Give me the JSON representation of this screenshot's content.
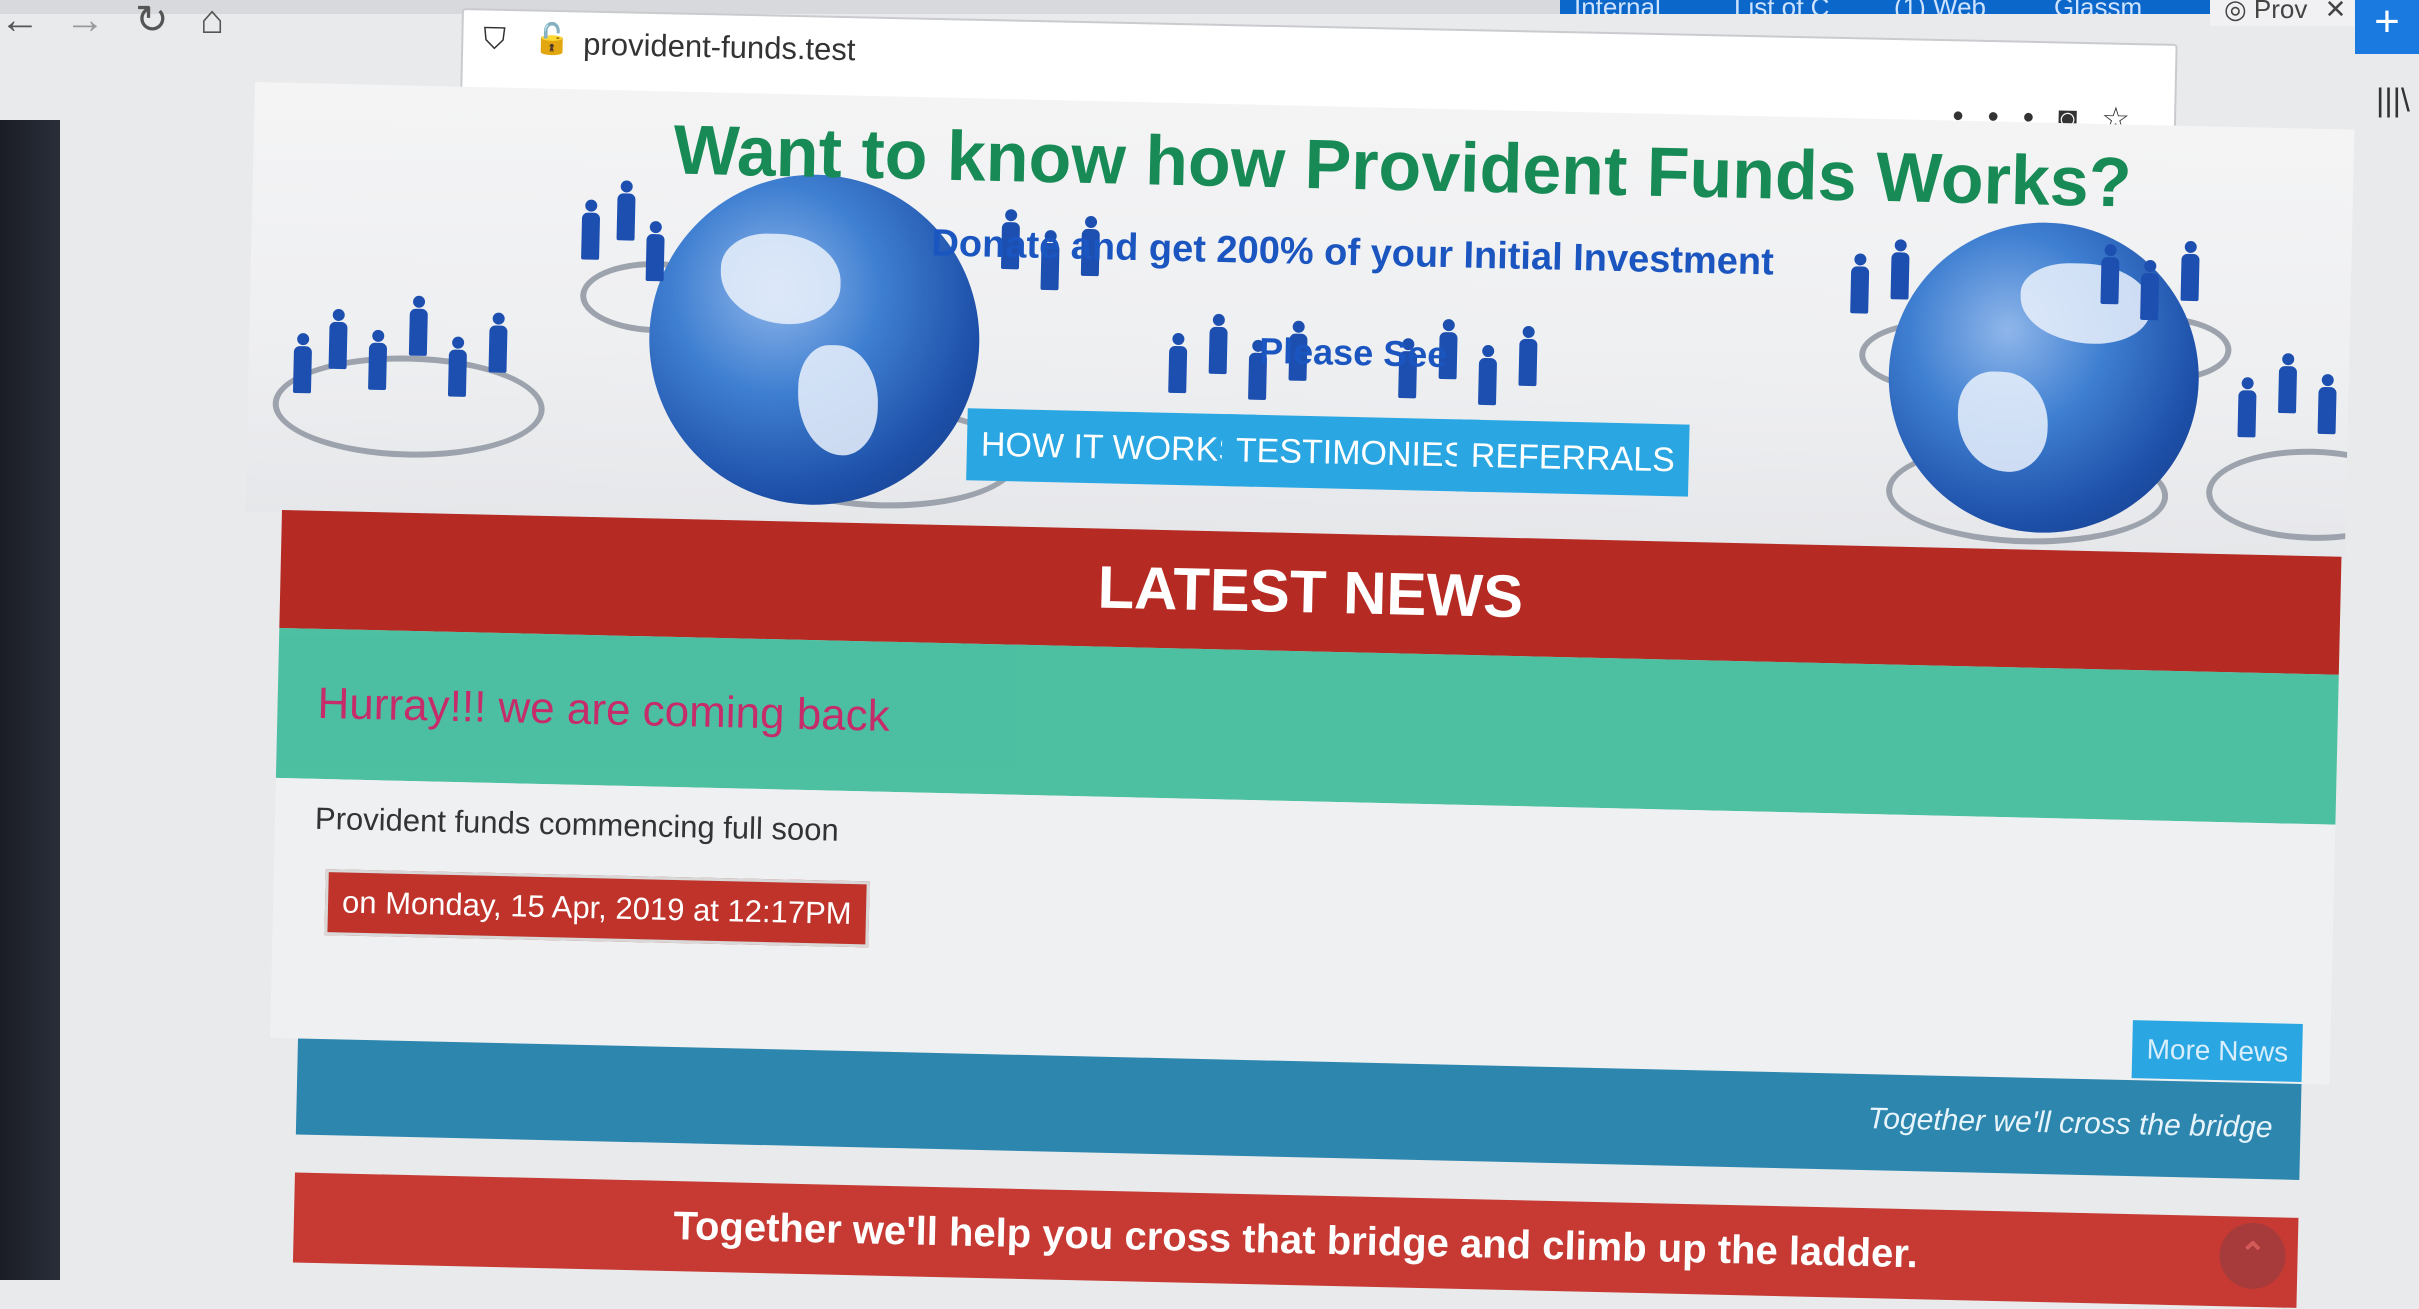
{
  "browser": {
    "tabs": [
      {
        "label": "Internal"
      },
      {
        "label": "List of C"
      },
      {
        "label": "(1) Web"
      },
      {
        "label": "Glassm"
      },
      {
        "label": "Prov"
      }
    ],
    "new_tab": "+",
    "close_tab": "✕",
    "url": "provident-funds.test",
    "menu_dots": "•••"
  },
  "hero": {
    "title": "Want to know how Provident Funds Works?",
    "subtitle": "Donate and get 200% of your Initial Investment",
    "please_see": "Please See",
    "buttons": [
      "HOW IT WORKS",
      "TESTIMONIES",
      "REFERRALS"
    ]
  },
  "news": {
    "heading": "LATEST NEWS",
    "banner": "Hurray!!! we are coming back",
    "body": "Provident funds commencing full soon",
    "date": "on Monday, 15 Apr, 2019  at 12:17PM",
    "more_button": "More News",
    "footer_tagline": "Together we'll cross the bridge",
    "bridge_text": "Together we'll help you cross that bridge and climb up the ladder."
  },
  "colors": {
    "accent": "#2aa7e2",
    "news_header": "#b52a22",
    "banner": "#3cbb9a",
    "title_green": "#178a55",
    "subtitle_blue": "#1b55c0"
  }
}
